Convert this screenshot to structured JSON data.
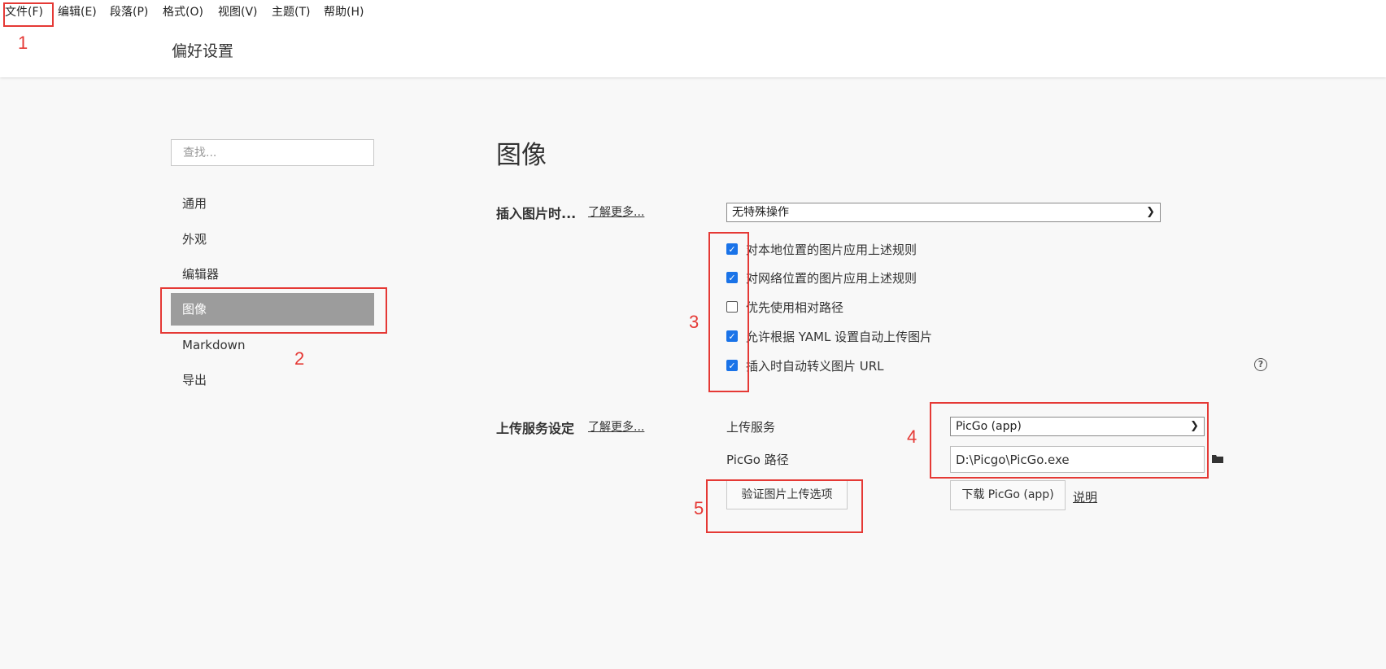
{
  "menubar": {
    "items": [
      "文件(F)",
      "编辑(E)",
      "段落(P)",
      "格式(O)",
      "视图(V)",
      "主题(T)",
      "帮助(H)"
    ]
  },
  "page_title": "偏好设置",
  "sidebar": {
    "search_placeholder": "查找...",
    "items": [
      {
        "label": "通用"
      },
      {
        "label": "外观"
      },
      {
        "label": "编辑器"
      },
      {
        "label": "图像",
        "active": true
      },
      {
        "label": "Markdown"
      },
      {
        "label": "导出"
      }
    ]
  },
  "main": {
    "section_title": "图像",
    "insert_image": {
      "label": "插入图片时...",
      "learn_more": "了解更多...",
      "select_value": "无特殊操作"
    },
    "checkboxes": [
      {
        "label": "对本地位置的图片应用上述规则",
        "checked": true
      },
      {
        "label": "对网络位置的图片应用上述规则",
        "checked": true
      },
      {
        "label": "优先使用相对路径",
        "checked": false
      },
      {
        "label": "允许根据 YAML 设置自动上传图片",
        "checked": true
      },
      {
        "label": "插入时自动转义图片 URL",
        "checked": true
      }
    ],
    "upload": {
      "label": "上传服务设定",
      "learn_more": "了解更多...",
      "service_label": "上传服务",
      "service_value": "PicGo (app)",
      "path_label": "PicGo 路径",
      "path_value": "D:\\Picgo\\PicGo.exe",
      "verify_button": "验证图片上传选项",
      "download_button": "下载 PicGo (app)",
      "explain_link": "说明"
    }
  },
  "annotations": [
    "1",
    "2",
    "3",
    "4",
    "5"
  ],
  "colors": {
    "annotation": "#e53935",
    "checkbox_checked": "#1a73e8",
    "sidebar_active": "#9c9c9c",
    "background": "#f8f8f8"
  },
  "icons": {
    "select_arrow": "chevron-down-icon",
    "help": "question-circle-icon",
    "folder": "folder-icon"
  }
}
